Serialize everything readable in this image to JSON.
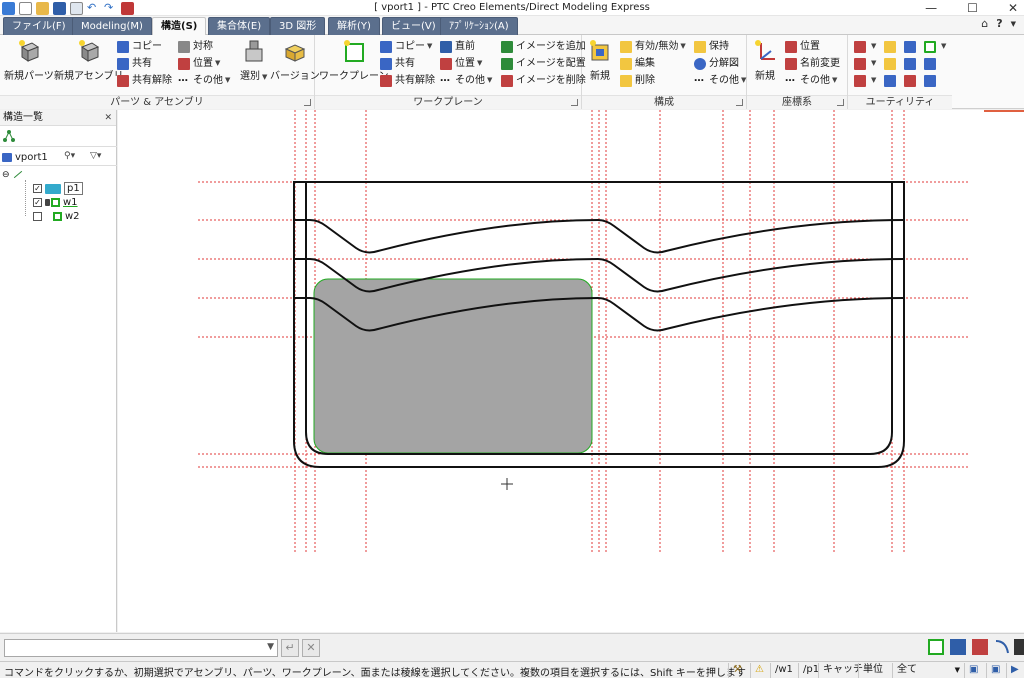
{
  "window": {
    "title": "[ vport1 ] - PTC Creo Elements/Direct Modeling Express",
    "minimize": "—",
    "maximize": "☐",
    "close": "✕"
  },
  "tabs": [
    {
      "label": "ファイル(F)"
    },
    {
      "label": "Modeling(M)"
    },
    {
      "label": "構造(S)"
    },
    {
      "label": "集合体(E)"
    },
    {
      "label": "3D 図形"
    },
    {
      "label": "解析(Y)"
    },
    {
      "label": "ビュー(V)"
    },
    {
      "label": "ｱﾌﾟﾘｹｰｼｮﾝ(A)"
    }
  ],
  "ribbon": {
    "groups": {
      "parts": "パーツ & アセンブリ",
      "workplane": "ワークプレーン",
      "config": "構成",
      "coords": "座標系",
      "utility": "ユーティリティ"
    },
    "parts": {
      "new_part": "新規パーツ",
      "new_assembly": "新規アセンブリ",
      "copy": "コピー",
      "share": "共有",
      "unshare": "共有解除",
      "symmetry": "対称",
      "position": "位置",
      "other": "その他",
      "select": "選別",
      "version": "バージョン"
    },
    "workplane": {
      "new_workplane": "ワークプレーン",
      "copy": "コピー",
      "share": "共有",
      "unshare": "共有解除",
      "direct": "直前",
      "position": "位置",
      "other": "その他",
      "add_image": "イメージを追加",
      "place_image": "イメージを配置",
      "delete_image": "イメージを削除"
    },
    "config": {
      "new": "新規",
      "toggle": "有効/無効",
      "edit": "編集",
      "delete": "削除",
      "keep": "保持",
      "explode": "分解図",
      "other": "その他"
    },
    "coords": {
      "new": "新規",
      "position": "位置",
      "rename": "名前変更",
      "other": "その他"
    }
  },
  "panel": {
    "title": "構造一覧",
    "pin": " ✕",
    "viewport": "vport1",
    "tree": [
      {
        "label": "p1",
        "checked": true
      },
      {
        "label": "w1",
        "checked": true
      },
      {
        "label": "w2",
        "checked": false
      }
    ]
  },
  "status": {
    "message": "コマンドをクリックするか、初期選択でアセンブリ、パーツ、ワークプレーン、面または稜線を選択してください。複数の項目を選択するには、Shift キーを押します",
    "workplane": "/w1",
    "part": "/p1",
    "catch": "キャッチ",
    "unit": "単位",
    "filter": "全て"
  },
  "colors": {
    "accent": "#5b6f8d",
    "construction_line": "#e23a3a",
    "profile": "#111111",
    "fill": "#a4a4a4",
    "fill_edge": "#22aa22"
  }
}
